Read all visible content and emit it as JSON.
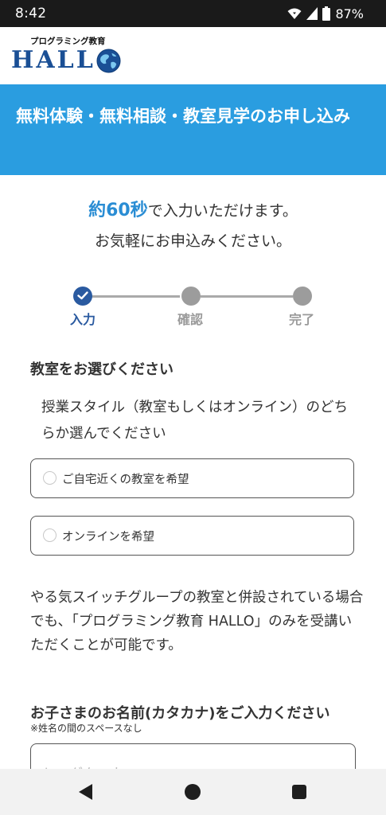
{
  "status_bar": {
    "time": "8:42",
    "battery": "87%"
  },
  "logo": {
    "tagline": "プログラミング教育",
    "wordmark": "HALL"
  },
  "banner": {
    "title": "無料体験・無料相談・教室見学のお申し込み"
  },
  "intro": {
    "accent": "約60秒",
    "line1_rest": "で入力いただけます。",
    "line2": "お気軽にお申込みください。"
  },
  "steps": [
    {
      "label": "入力",
      "state": "active"
    },
    {
      "label": "確認",
      "state": "inactive"
    },
    {
      "label": "完了",
      "state": "inactive"
    }
  ],
  "classroom_section": {
    "title": "教室をお選びください",
    "description": "授業スタイル（教室もしくはオンライン）のどちらか選んでください",
    "options": [
      {
        "label": "ご自宅近くの教室を希望",
        "selected": false
      },
      {
        "label": "オンラインを希望",
        "selected": false
      }
    ]
  },
  "notice": "やる気スイッチグループの教室と併設されている場合でも、「プログラミング教育 HALLO」のみを受講いただくことが可能です。",
  "name_section": {
    "title": "お子さまのお名前(カタカナ)をご入力ください",
    "note": "※姓名の間のスペースなし",
    "placeholder": "ヤマダタロウ",
    "value": ""
  },
  "colors": {
    "banner": "#2a9de0",
    "accent": "#2a8dd4",
    "step_active": "#2a5aa0",
    "step_inactive": "#9c9c9c",
    "logo": "#1a4f95"
  }
}
